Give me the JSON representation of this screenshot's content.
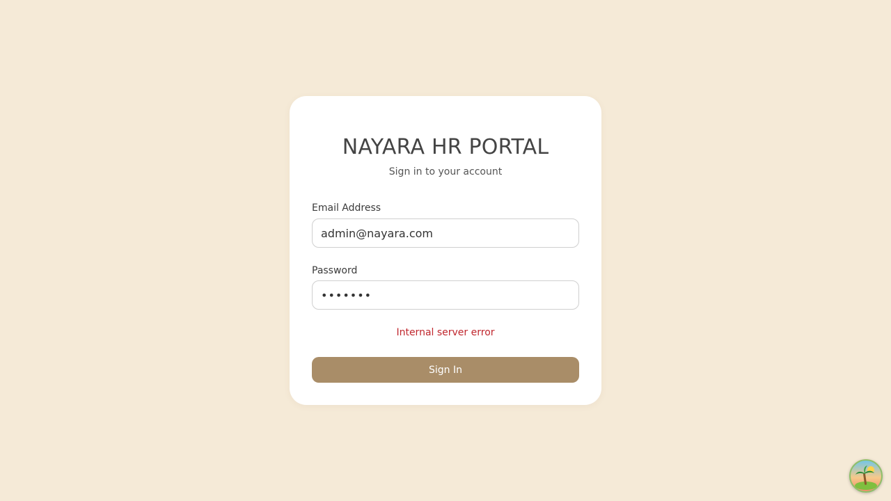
{
  "login": {
    "title": "NAYARA HR PORTAL",
    "subtitle": "Sign in to your account",
    "email_label": "Email Address",
    "email_value": "admin@nayara.com",
    "password_label": "Password",
    "password_value": "•••••••",
    "error_message": "Internal server error",
    "signin_label": "Sign In"
  },
  "colors": {
    "background": "#f5ead7",
    "accent_button": "#a98d68",
    "error": "#c0262d"
  },
  "widgets": {
    "assistant_icon": "palm-island-icon"
  }
}
